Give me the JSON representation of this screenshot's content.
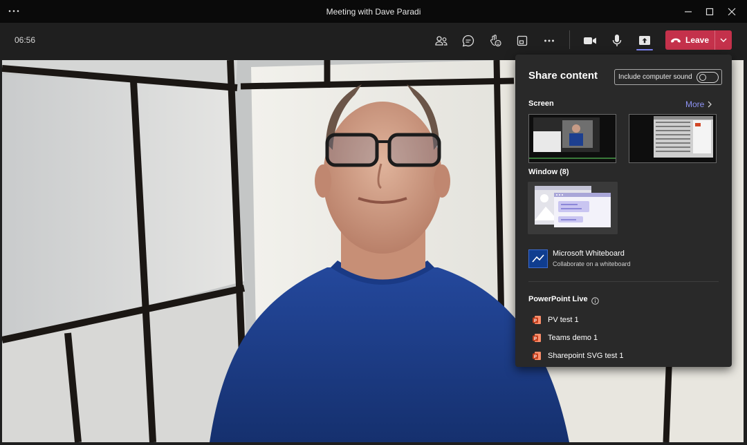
{
  "window": {
    "title": "Meeting with Dave Paradi"
  },
  "toolbar": {
    "timer": "06:56",
    "leave_label": "Leave",
    "icons": [
      "people-icon",
      "chat-icon",
      "reactions-icon",
      "view-icon",
      "more-icon",
      "camera-icon",
      "mic-icon",
      "share-icon"
    ]
  },
  "share_panel": {
    "title": "Share content",
    "include_sound_label": "Include computer sound",
    "include_sound_on": false,
    "screen_label": "Screen",
    "more_label": "More",
    "window_label": "Window (8)",
    "whiteboard": {
      "title": "Microsoft Whiteboard",
      "subtitle": "Collaborate on a whiteboard"
    },
    "powerpoint_label": "PowerPoint Live",
    "files": [
      {
        "name": "PV test 1"
      },
      {
        "name": "Teams demo 1"
      },
      {
        "name": "Sharepoint SVG test 1"
      }
    ]
  },
  "colors": {
    "leave": "#c4314b",
    "accent": "#7f85f5",
    "panel": "#292929",
    "video_shirt": "#1d3f8f"
  }
}
